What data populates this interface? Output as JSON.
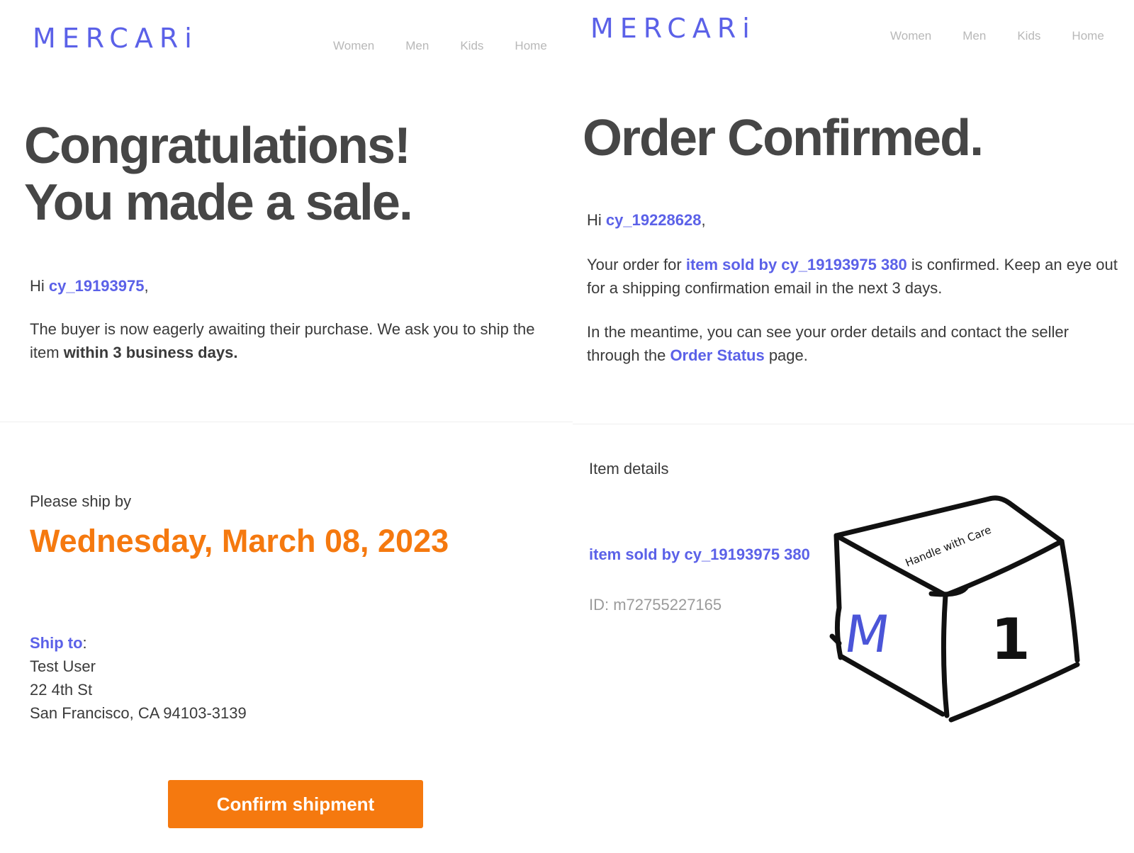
{
  "left": {
    "logo": "MERCARi",
    "nav": [
      "Women",
      "Men",
      "Kids",
      "Home"
    ],
    "headline_line1": "Congratulations!",
    "headline_line2": "You made a sale.",
    "greeting_prefix": "Hi ",
    "username": "cy_19193975",
    "greeting_suffix": ",",
    "message_text": "The buyer is now eagerly awaiting their purchase. We ask you to ship the item ",
    "message_bold": "within 3 business days.",
    "ship_by_label": "Please ship by",
    "ship_by_date": "Wednesday, March 08, 2023",
    "ship_to_label": "Ship to",
    "ship_to_colon": ":",
    "address": [
      "Test User",
      "22 4th St",
      "San Francisco, CA 94103-3139"
    ],
    "confirm_button": "Confirm shipment"
  },
  "right": {
    "logo": "MERCARi",
    "nav": [
      "Women",
      "Men",
      "Kids",
      "Home"
    ],
    "headline": "Order Confirmed.",
    "greeting_prefix": "Hi ",
    "username": "cy_19228628",
    "greeting_suffix": ",",
    "order_prefix": "Your order for ",
    "order_item_link": "item sold by cy_19193975 380",
    "order_suffix": " is confirmed. Keep an eye out for a shipping confirmation email in the next 3 days.",
    "meantime_prefix": "In the meantime, you can see your order details and contact the seller through the ",
    "order_status_link": "Order Status",
    "meantime_suffix": " page.",
    "item_details_label": "Item details",
    "item_name": "item sold by cy_19193975 380",
    "item_id": "ID: m72755227165",
    "box_caption": "Handle with Care",
    "box_letter": "M",
    "box_number": "1"
  },
  "colors": {
    "brand": "#5b61e8",
    "accent_orange": "#f5790f",
    "heading": "#464646",
    "nav": "#b8b8b8"
  },
  "icons": {
    "box_illustration": "handle-with-care-box-icon"
  }
}
